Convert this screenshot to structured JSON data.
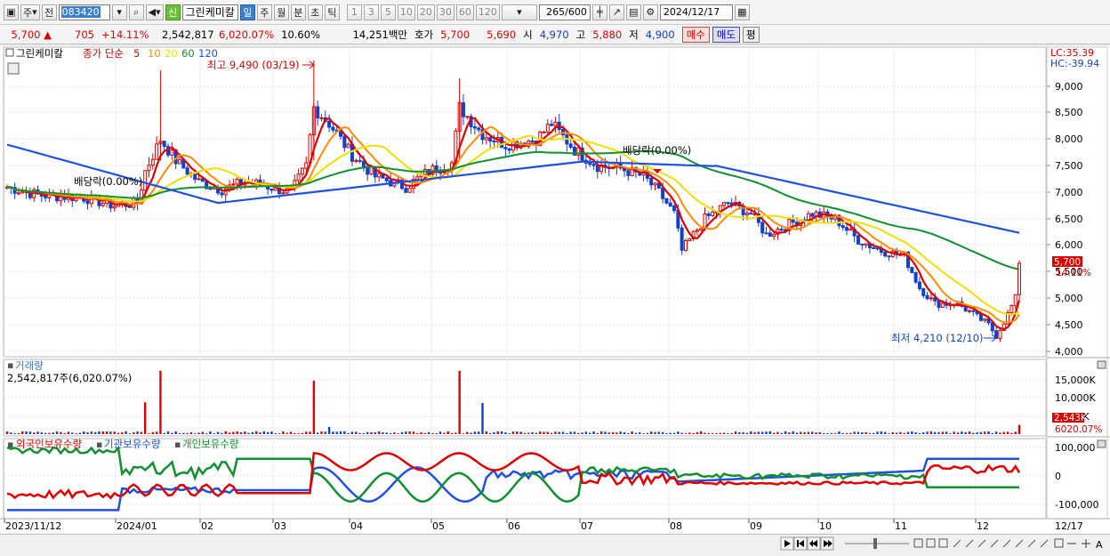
{
  "toolbar": {
    "market": "주",
    "scope": "전",
    "code": "083420",
    "new_badge": "신",
    "stock_name": "그린케미칼",
    "periods": [
      "일",
      "주",
      "월",
      "분",
      "초",
      "틱"
    ],
    "active_period": "일",
    "minute_options": [
      "1",
      "3",
      "5",
      "10",
      "20",
      "30",
      "60",
      "120"
    ],
    "count": "265/600",
    "date": "2024/12/17"
  },
  "quote": {
    "price": "5,700",
    "arrow": "▲",
    "change": "705",
    "change_pct": "+14.11%",
    "volume": "2,542,817",
    "volume_ratio": "6,020.07%",
    "turnover": "10.60%",
    "amount": "14,251백만",
    "hoga_label": "호가",
    "ask": "5,700",
    "bid": "5,690",
    "open_label": "시",
    "open": "4,970",
    "high_label": "고",
    "high": "5,880",
    "low_label": "저",
    "low": "4,900",
    "buy": "매수",
    "sell": "매도",
    "flat": "평"
  },
  "price_panel": {
    "name": "그린케미칼",
    "ma_label": "종가 단순",
    "ma_periods": [
      "5",
      "10",
      "20",
      "60",
      "120"
    ],
    "ma_colors": [
      "#e00000",
      "#ff8c00",
      "#f0e000",
      "#109030",
      "#2050e0"
    ],
    "lc": "LC:35.39",
    "hc": "HC:-39.94",
    "yticks": [
      "9,000",
      "8,500",
      "8,000",
      "7,500",
      "7,000",
      "6,500",
      "6,000",
      "5,500",
      "5,000",
      "4,500",
      "4,000"
    ],
    "high_note": "최고 9,490 (03/19)",
    "low_note": "최저 4,210 (12/10)",
    "dividend_note": "배당락(0.00%)",
    "last_price_tag": "5,700",
    "last_pct_tag": "14.11%"
  },
  "volume_panel": {
    "title": "거래량",
    "value": "2,542,817주(6,020.07%)",
    "yticks": [
      "15,000K",
      "10,000K",
      "5,000K"
    ],
    "last_tag": "2,543K",
    "pct_tag": "6020.07%"
  },
  "holdings_panel": {
    "legend": [
      "외국인보유수량",
      "기관보유수량",
      "개인보유수량"
    ],
    "colors": [
      "#e00000",
      "#2050e0",
      "#109030"
    ],
    "yticks": [
      "100,000",
      "0",
      "-100,000"
    ]
  },
  "x_axis": {
    "labels": [
      "2023/11/12",
      "2024/01",
      "02",
      "03",
      "04",
      "05",
      "06",
      "07",
      "08",
      "09",
      "10",
      "11",
      "12"
    ],
    "last_label": "12/17"
  }
}
